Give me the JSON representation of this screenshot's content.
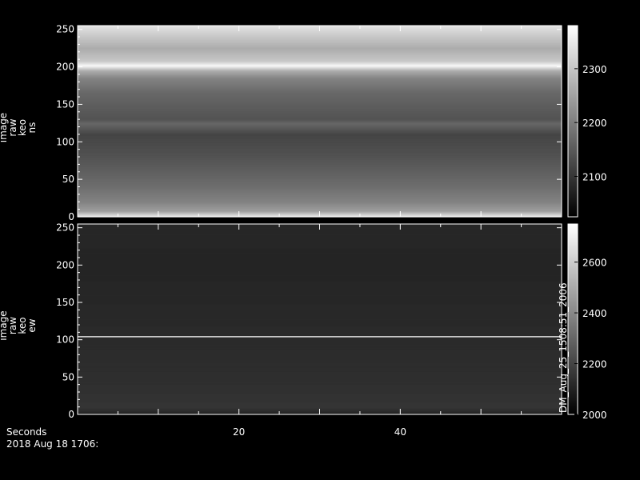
{
  "chart_data": [
    {
      "type": "heatmap",
      "panel": "top",
      "ylabel": [
        "image",
        "raw",
        "keo",
        "ns"
      ],
      "yticks": [
        "0",
        "50",
        "100",
        "150",
        "200",
        "250"
      ],
      "ylim": [
        0,
        255
      ],
      "xlim": [
        0,
        60
      ],
      "colorbar": {
        "ticks": [
          "2100",
          "2200",
          "2300"
        ],
        "range": [
          2025,
          2380
        ]
      },
      "profile": [
        {
          "y": 0,
          "v": 2360
        },
        {
          "y": 4,
          "v": 2300
        },
        {
          "y": 8,
          "v": 2240
        },
        {
          "y": 20,
          "v": 2200
        },
        {
          "y": 40,
          "v": 2170
        },
        {
          "y": 80,
          "v": 2130
        },
        {
          "y": 110,
          "v": 2110
        },
        {
          "y": 125,
          "v": 2160
        },
        {
          "y": 130,
          "v": 2130
        },
        {
          "y": 165,
          "v": 2160
        },
        {
          "y": 185,
          "v": 2200
        },
        {
          "y": 195,
          "v": 2260
        },
        {
          "y": 202,
          "v": 2370
        },
        {
          "y": 208,
          "v": 2300
        },
        {
          "y": 225,
          "v": 2260
        },
        {
          "y": 245,
          "v": 2310
        },
        {
          "y": 255,
          "v": 2340
        }
      ]
    },
    {
      "type": "heatmap",
      "panel": "bottom",
      "ylabel": [
        "image",
        "raw",
        "keo",
        "ew"
      ],
      "yticks": [
        "0",
        "50",
        "100",
        "150",
        "200",
        "250"
      ],
      "ylim": [
        0,
        255
      ],
      "xlim": [
        0,
        60
      ],
      "colorbar": {
        "ticks": [
          "2000",
          "2200",
          "2400",
          "2600"
        ],
        "range": [
          2000,
          2750
        ]
      },
      "marker_line_y": 104,
      "colorbar_annotation": "DM_Aug_25_1508:51_2006",
      "profile": [
        {
          "y": 0,
          "v": 2040
        },
        {
          "y": 4,
          "v": 2100
        },
        {
          "y": 10,
          "v": 2130
        },
        {
          "y": 50,
          "v": 2110
        },
        {
          "y": 100,
          "v": 2100
        },
        {
          "y": 150,
          "v": 2090
        },
        {
          "y": 200,
          "v": 2080
        },
        {
          "y": 255,
          "v": 2090
        }
      ]
    }
  ],
  "x_axis": {
    "label": "Seconds",
    "ticks": [
      {
        "v": 20,
        "label": "20"
      },
      {
        "v": 40,
        "label": "40"
      }
    ],
    "date_label": "2018 Aug 18 1706:"
  }
}
